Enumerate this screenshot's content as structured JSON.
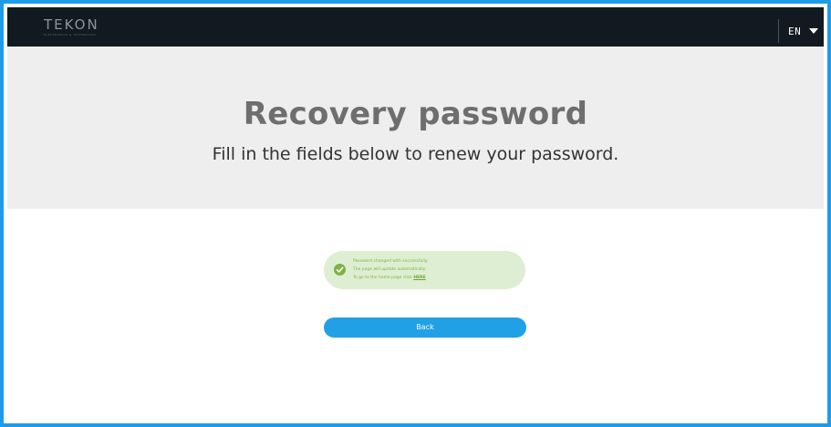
{
  "header": {
    "logo_text": "TEKON",
    "logo_tagline": "ELECTRONICS & TECHNOLOGY",
    "language": "EN",
    "caret_icon": "caret-down-icon"
  },
  "hero": {
    "title": "Recovery password",
    "subtitle": "Fill in the fields below to renew your password."
  },
  "alert": {
    "icon": "check-circle-icon",
    "line1": "Password changed with successfully.",
    "line2": "The page will update automatically.",
    "line3_prefix": "To go to the home page click",
    "link_text": "HERE",
    "color": "#7cb342",
    "background": "#deeed2"
  },
  "back_button": {
    "label": "Back",
    "color": "#22a0e6"
  },
  "colors": {
    "frame_border": "#1e9bea",
    "topbar": "#121920",
    "hero_background": "#eeeeee"
  }
}
